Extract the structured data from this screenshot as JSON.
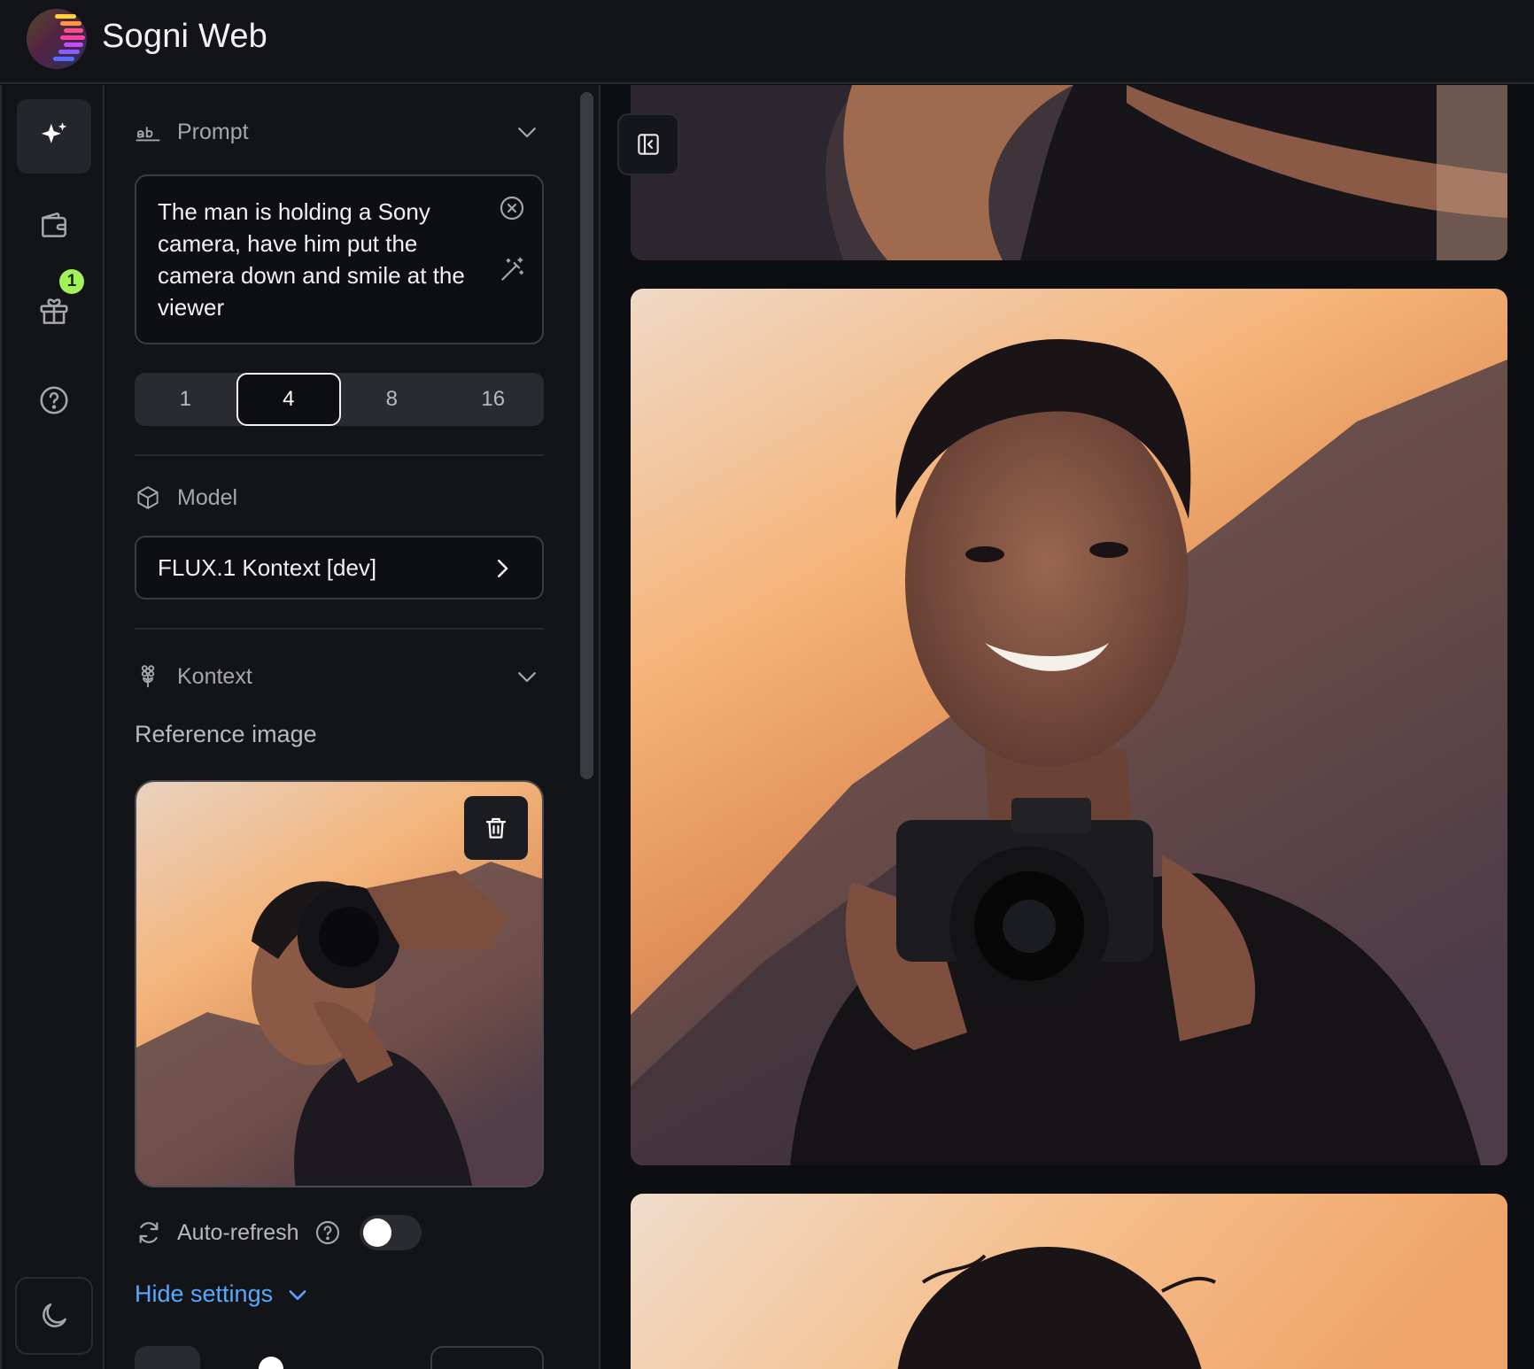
{
  "app": {
    "title": "Sogni Web"
  },
  "rail": {
    "items": [
      "create-icon",
      "wallet-icon",
      "gift-icon",
      "help-icon"
    ],
    "gift_badge": "1"
  },
  "prompt": {
    "label": "Prompt",
    "text": "The man is holding a Sony camera, have him put the camera down and smile at the viewer"
  },
  "image_count": {
    "options": [
      "1",
      "4",
      "8",
      "16"
    ],
    "selected": "4"
  },
  "model": {
    "label": "Model",
    "value": "FLUX.1 Kontext [dev]"
  },
  "kontext": {
    "label": "Kontext",
    "reference_label": "Reference image"
  },
  "auto_refresh": {
    "label": "Auto-refresh",
    "enabled": false
  },
  "hide_settings": {
    "label": "Hide settings"
  },
  "colors": {
    "accent": "#5aa7ff",
    "badge": "#a4f25a",
    "background": "#0d0e12",
    "panel": "#131418"
  }
}
